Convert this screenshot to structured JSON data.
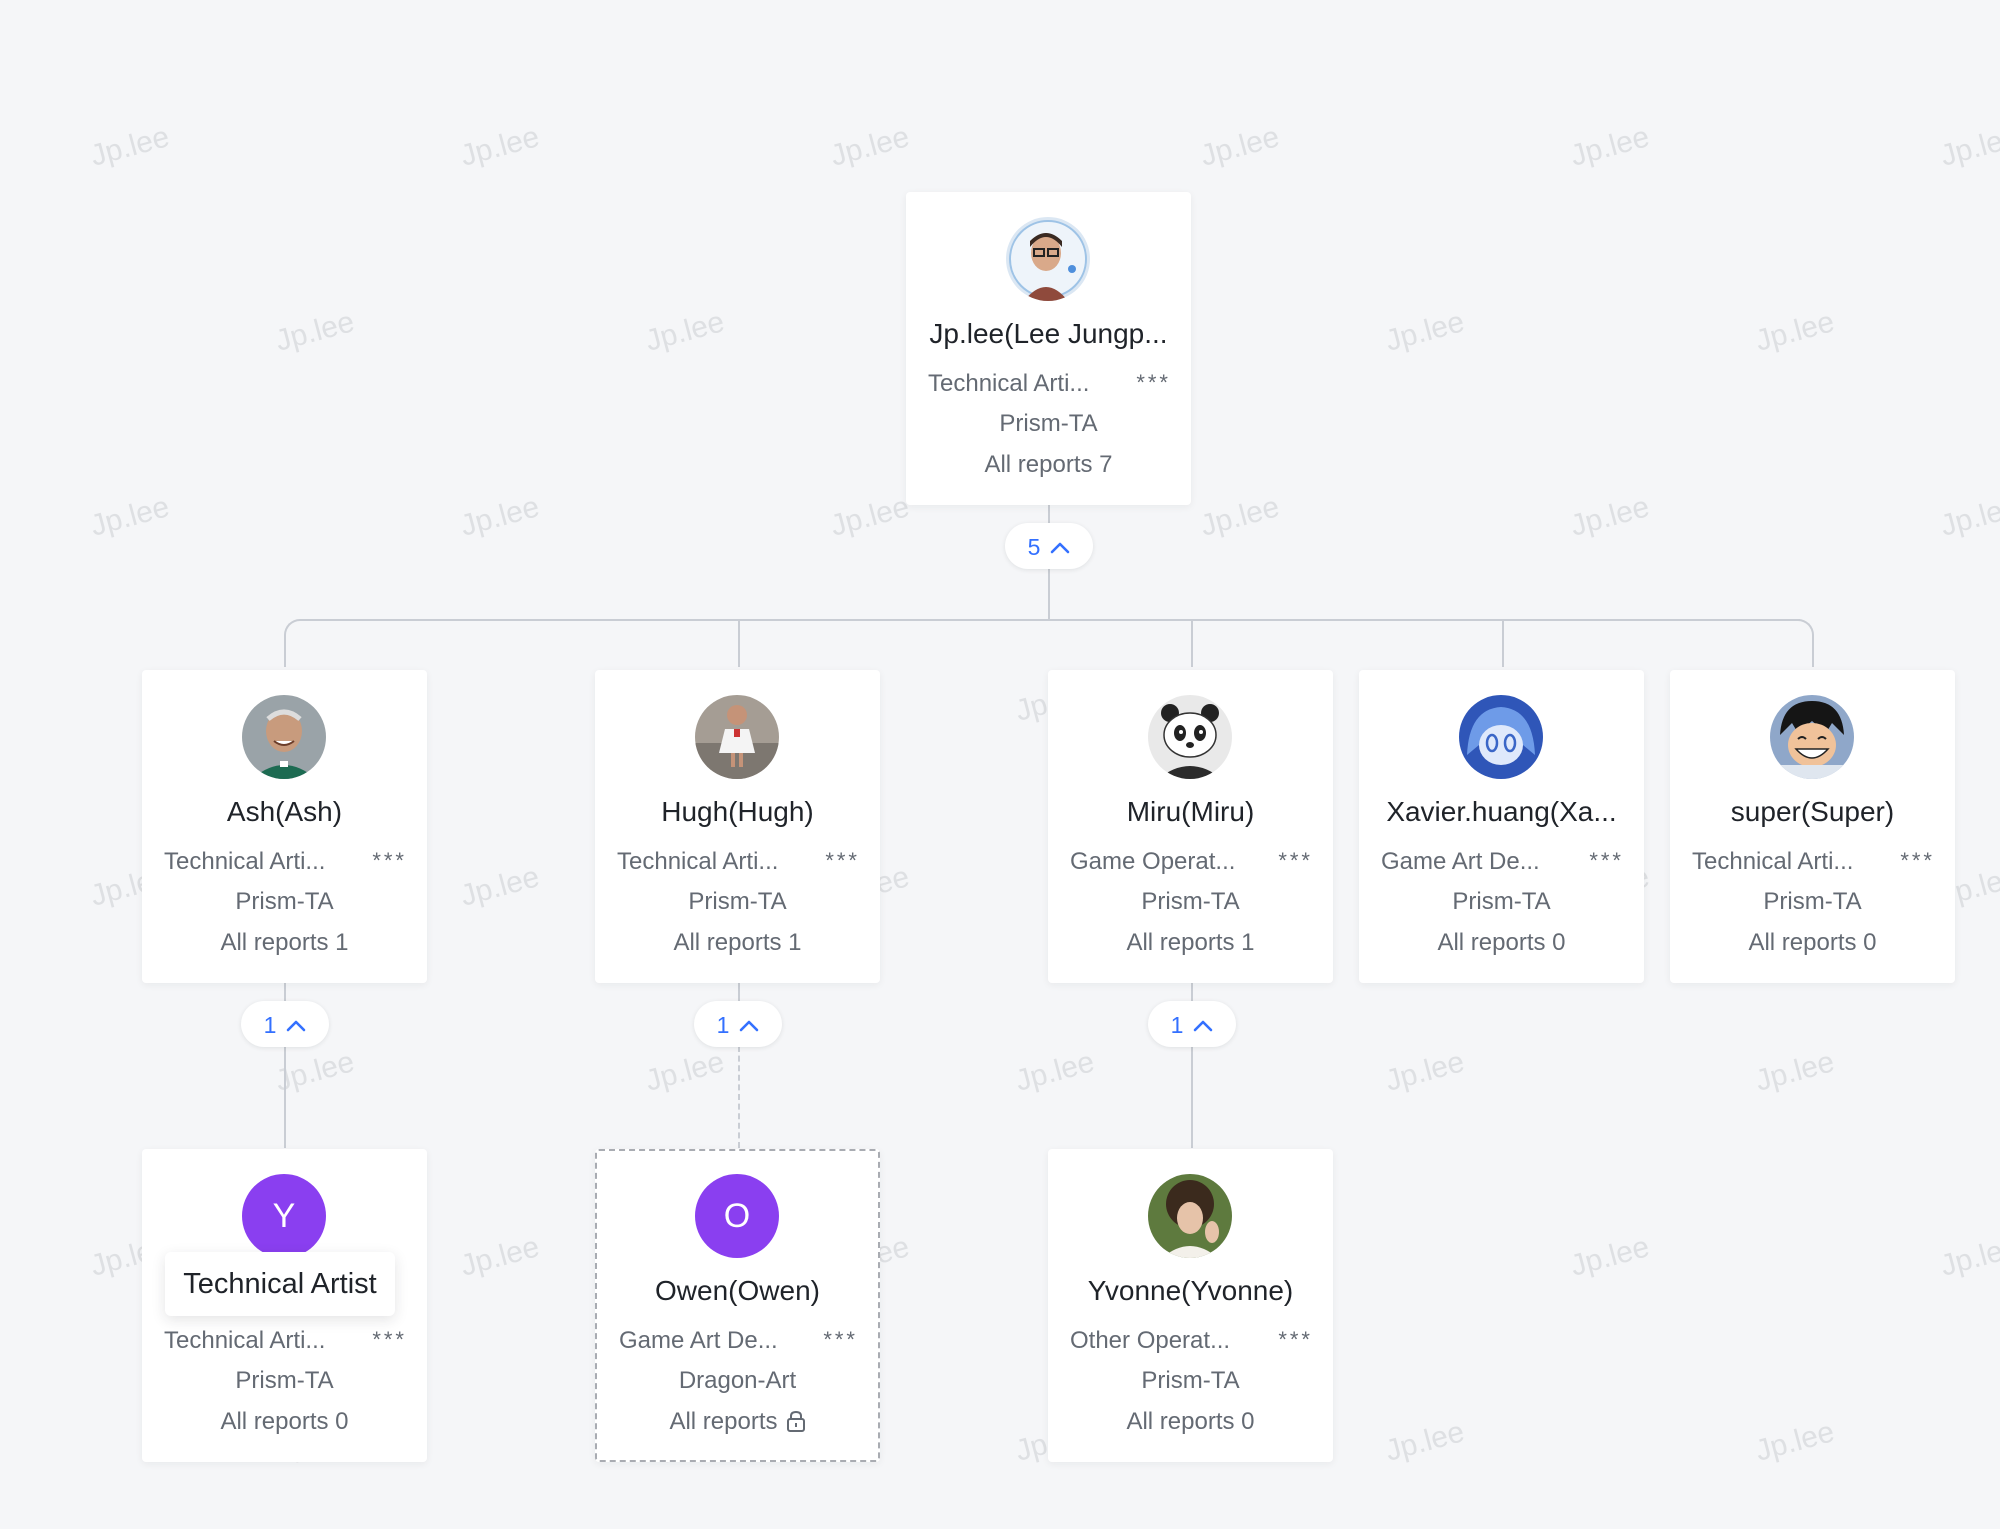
{
  "watermark_text": "Jp.lee",
  "root": {
    "name": "Jp.lee(Lee Jungp...",
    "title": "Technical Arti...",
    "masked": "***",
    "department": "Prism-TA",
    "reports_label": "All reports 7",
    "avatar_icon": "person-photo-avatar",
    "expand_count": "5"
  },
  "reports": [
    {
      "name": "Ash(Ash)",
      "title": "Technical Arti...",
      "masked": "***",
      "department": "Prism-TA",
      "reports_label": "All reports 1",
      "avatar_icon": "person-photo-avatar",
      "expand_count": "1"
    },
    {
      "name": "Hugh(Hugh)",
      "title": "Technical Arti...",
      "masked": "***",
      "department": "Prism-TA",
      "reports_label": "All reports 1",
      "avatar_icon": "child-photo-avatar",
      "expand_count": "1"
    },
    {
      "name": "Miru(Miru)",
      "title": "Game Operat...",
      "masked": "***",
      "department": "Prism-TA",
      "reports_label": "All reports 1",
      "avatar_icon": "panda-avatar",
      "expand_count": "1"
    },
    {
      "name": "Xavier.huang(Xa...",
      "title": "Game Art De...",
      "masked": "***",
      "department": "Prism-TA",
      "reports_label": "All reports 0",
      "avatar_icon": "anime-character-avatar"
    },
    {
      "name": "super(Super)",
      "title": "Technical Arti...",
      "masked": "***",
      "department": "Prism-TA",
      "reports_label": "All reports 0",
      "avatar_icon": "cartoon-character-avatar"
    }
  ],
  "sub_reports": [
    {
      "name": "",
      "title": "Technical Arti...",
      "masked": "***",
      "department": "Prism-TA",
      "reports_label": "All reports 0",
      "avatar_letter": "Y",
      "avatar_color": "#8a3ff0"
    },
    {
      "name": "Owen(Owen)",
      "title": "Game Art De...",
      "masked": "***",
      "department": "Dragon-Art",
      "reports_label": "All reports",
      "avatar_letter": "O",
      "avatar_color": "#8a3ff0",
      "lock_icon": "lock-icon"
    },
    {
      "name": "Yvonne(Yvonne)",
      "title": "Other Operat...",
      "masked": "***",
      "department": "Prism-TA",
      "reports_label": "All reports 0",
      "avatar_icon": "person-photo-avatar"
    }
  ],
  "tooltip": {
    "text": "Technical Artist"
  },
  "colors": {
    "accent": "#3370ff",
    "letter_avatar": "#8a3ff0",
    "connector": "#c9cdd4"
  }
}
